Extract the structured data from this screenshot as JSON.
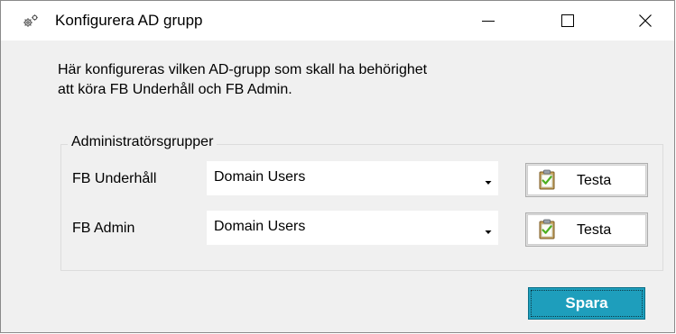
{
  "window": {
    "title": "Konfigurera AD grupp",
    "title_icon": "gear-icon",
    "controls": [
      "minimize-icon",
      "maximize-icon",
      "close-icon"
    ]
  },
  "description": "Här konfigureras vilken AD-grupp som skall ha behörighet\natt köra FB Underhåll och FB Admin.",
  "group": {
    "title": "Administratörsgrupper",
    "rows": [
      {
        "label": "FB Underhåll",
        "selected": "Domain Users",
        "button_label": "Testa",
        "button_icon": "clipboard-check-icon"
      },
      {
        "label": "FB Admin",
        "selected": "Domain Users",
        "button_label": "Testa",
        "button_icon": "clipboard-check-icon"
      }
    ]
  },
  "save_button": {
    "label": "Spara"
  },
  "colors": {
    "save_button_bg": "#1e9ebc",
    "window_bg": "#f0f0f0",
    "titlebar_bg": "#ffffff"
  }
}
